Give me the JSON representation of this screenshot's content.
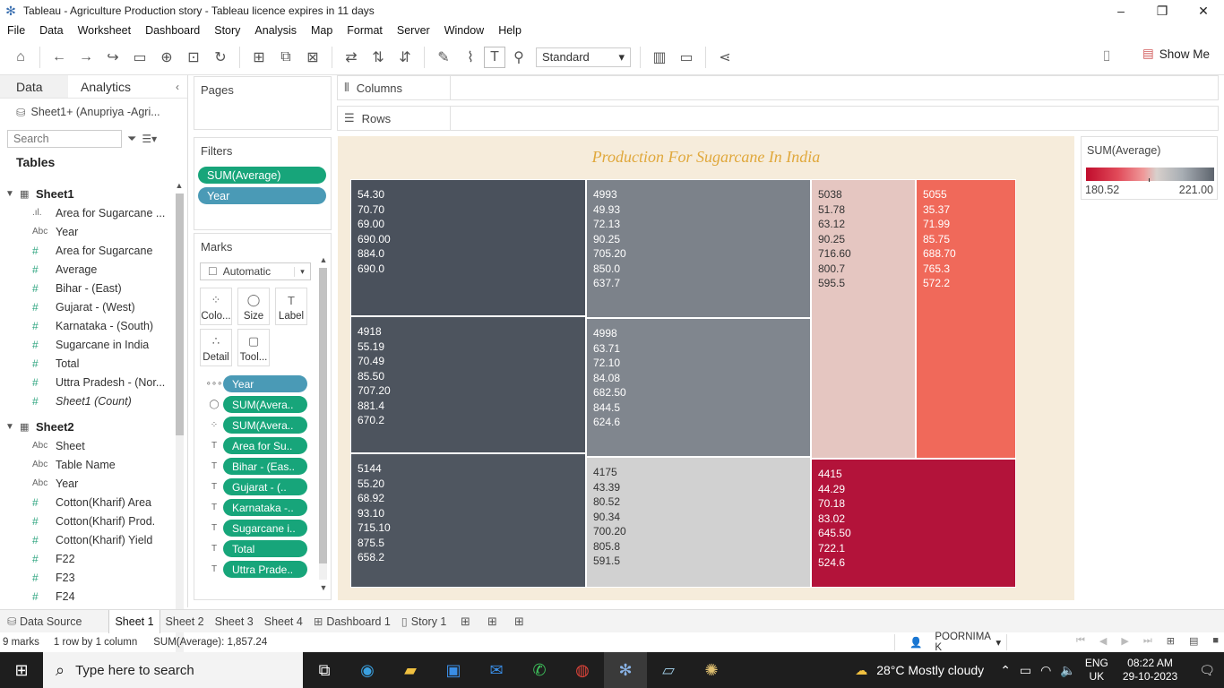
{
  "window": {
    "title": "Tableau - Agriculture Production story - Tableau licence expires in 11 days",
    "minimize": "–",
    "maximize": "❐",
    "close": "✕"
  },
  "menu": [
    "File",
    "Data",
    "Worksheet",
    "Dashboard",
    "Story",
    "Analysis",
    "Map",
    "Format",
    "Server",
    "Window",
    "Help"
  ],
  "toolbar": {
    "fit_value": "Standard",
    "show_me_label": "Show Me"
  },
  "data_pane": {
    "tab_data": "Data",
    "tab_analytics": "Analytics",
    "collapse": "‹",
    "datasource": "Sheet1+ (Anupriya -Agri...",
    "search_placeholder": "Search",
    "tables_title": "Tables",
    "sheet1": {
      "name": "Sheet1",
      "fields": [
        {
          "type": ".ıl.",
          "name": "Area for Sugarcane ...",
          "measure": false,
          "italic": false
        },
        {
          "type": "Abc",
          "name": "Year",
          "measure": false,
          "italic": false
        },
        {
          "type": "#",
          "name": "Area for Sugarcane",
          "measure": true,
          "italic": false
        },
        {
          "type": "#",
          "name": "Average",
          "measure": true,
          "italic": false
        },
        {
          "type": "#",
          "name": "Bihar - (East)",
          "measure": true,
          "italic": false
        },
        {
          "type": "#",
          "name": "Gujarat - (West)",
          "measure": true,
          "italic": false
        },
        {
          "type": "#",
          "name": "Karnataka - (South)",
          "measure": true,
          "italic": false
        },
        {
          "type": "#",
          "name": "Sugarcane in India",
          "measure": true,
          "italic": false
        },
        {
          "type": "#",
          "name": "Total",
          "measure": true,
          "italic": false
        },
        {
          "type": "#",
          "name": "Uttra Pradesh - (Nor...",
          "measure": true,
          "italic": false
        },
        {
          "type": "#",
          "name": "Sheet1 (Count)",
          "measure": true,
          "italic": true
        }
      ]
    },
    "sheet2": {
      "name": "Sheet2",
      "fields": [
        {
          "type": "Abc",
          "name": "Sheet",
          "measure": false,
          "italic": false
        },
        {
          "type": "Abc",
          "name": "Table Name",
          "measure": false,
          "italic": false
        },
        {
          "type": "Abc",
          "name": "Year",
          "measure": false,
          "italic": false
        },
        {
          "type": "#",
          "name": "Cotton(Kharif) Area",
          "measure": true,
          "italic": false
        },
        {
          "type": "#",
          "name": "Cotton(Kharif) Prod.",
          "measure": true,
          "italic": false
        },
        {
          "type": "#",
          "name": "Cotton(Kharif) Yield",
          "measure": true,
          "italic": false
        },
        {
          "type": "#",
          "name": "F22",
          "measure": true,
          "italic": false
        },
        {
          "type": "#",
          "name": "F23",
          "measure": true,
          "italic": false
        },
        {
          "type": "#",
          "name": "F24",
          "measure": true,
          "italic": false
        }
      ]
    }
  },
  "pages": {
    "title": "Pages"
  },
  "filters": {
    "title": "Filters",
    "pills": [
      {
        "label": "SUM(Average)",
        "color": "green"
      },
      {
        "label": "Year",
        "color": "blue"
      }
    ]
  },
  "marks": {
    "title": "Marks",
    "type": "Automatic",
    "buttons": [
      {
        "label": "Colo...",
        "icon": "color-icon",
        "glyph": "⁘"
      },
      {
        "label": "Size",
        "icon": "size-icon",
        "glyph": "◯"
      },
      {
        "label": "Label",
        "icon": "label-icon",
        "glyph": "T"
      },
      {
        "label": "Detail",
        "icon": "detail-icon",
        "glyph": "∴"
      },
      {
        "label": "Tool...",
        "icon": "tooltip-icon",
        "glyph": "▢"
      }
    ],
    "fields": [
      {
        "icon": "detail-icon",
        "glyph": "∘∘∘",
        "label": "Year",
        "color": "blue"
      },
      {
        "icon": "size-icon",
        "glyph": "◯",
        "label": "SUM(Avera..",
        "color": "green"
      },
      {
        "icon": "color-icon",
        "glyph": "⁘",
        "label": "SUM(Avera..",
        "color": "green"
      },
      {
        "icon": "label-icon",
        "glyph": "T",
        "label": "Area for Su..",
        "color": "green"
      },
      {
        "icon": "label-icon",
        "glyph": "T",
        "label": "Bihar - (Eas..",
        "color": "green"
      },
      {
        "icon": "label-icon",
        "glyph": "T",
        "label": "Gujarat - (..",
        "color": "green"
      },
      {
        "icon": "label-icon",
        "glyph": "T",
        "label": "Karnataka -..",
        "color": "green"
      },
      {
        "icon": "label-icon",
        "glyph": "T",
        "label": "Sugarcane i..",
        "color": "green"
      },
      {
        "icon": "label-icon",
        "glyph": "T",
        "label": "Total",
        "color": "green"
      },
      {
        "icon": "label-icon",
        "glyph": "T",
        "label": "Uttra Prade..",
        "color": "green"
      }
    ]
  },
  "shelves": {
    "columns": "Columns",
    "rows": "Rows"
  },
  "viz": {
    "title": "Production For Sugarcane In India",
    "background": "#f6ecdb",
    "title_color": "#e0a83c"
  },
  "chart_data": {
    "type": "treemap",
    "title": "Production For Sugarcane In India",
    "cells": [
      {
        "values": [
          "54.30",
          "70.70",
          "69.00",
          "690.00",
          "884.0",
          "690.0"
        ],
        "color": "#4a515c",
        "text": "light"
      },
      {
        "values": [
          "4918",
          "55.19",
          "70.49",
          "85.50",
          "707.20",
          "881.4",
          "670.2"
        ],
        "color": "#4d545e",
        "text": "light"
      },
      {
        "values": [
          "5144",
          "55.20",
          "68.92",
          "93.10",
          "715.10",
          "875.5",
          "658.2"
        ],
        "color": "#4f5660",
        "text": "light"
      },
      {
        "values": [
          "4993",
          "49.93",
          "72.13",
          "90.25",
          "705.20",
          "850.0",
          "637.7"
        ],
        "color": "#7c828a",
        "text": "light"
      },
      {
        "values": [
          "4998",
          "63.71",
          "72.10",
          "84.08",
          "682.50",
          "844.5",
          "624.6"
        ],
        "color": "#80868e",
        "text": "light"
      },
      {
        "values": [
          "4175",
          "43.39",
          "80.52",
          "90.34",
          "700.20",
          "805.8",
          "591.5"
        ],
        "color": "#d1d1d1",
        "text": "dark"
      },
      {
        "values": [
          "5038",
          "51.78",
          "63.12",
          "90.25",
          "716.60",
          "800.7",
          "595.5"
        ],
        "color": "#e5c6c1",
        "text": "dark"
      },
      {
        "values": [
          "5055",
          "35.37",
          "71.99",
          "85.75",
          "688.70",
          "765.3",
          "572.2"
        ],
        "color": "#f0695a",
        "text": "light"
      },
      {
        "values": [
          "4415",
          "44.29",
          "70.18",
          "83.02",
          "645.50",
          "722.1",
          "524.6"
        ],
        "color": "#b3133a",
        "text": "light"
      }
    ],
    "legend": {
      "title": "SUM(Average)",
      "min": "180.52",
      "max": "221.00"
    }
  },
  "tabs": {
    "data_source": "Data Source",
    "sheets": [
      {
        "label": "Sheet 1",
        "active": true,
        "icon": ""
      },
      {
        "label": "Sheet 2",
        "active": false,
        "icon": ""
      },
      {
        "label": "Sheet 3",
        "active": false,
        "icon": ""
      },
      {
        "label": "Sheet 4",
        "active": false,
        "icon": ""
      },
      {
        "label": "Dashboard 1",
        "active": false,
        "icon": "⊞"
      },
      {
        "label": "Story 1",
        "active": false,
        "icon": "▯"
      }
    ]
  },
  "status": {
    "marks": "9 marks",
    "rows": "1 row  by  1 column",
    "sum": "SUM(Average): 1,857.24",
    "user": "POORNIMA K"
  },
  "taskbar": {
    "search_placeholder": "Type here to search",
    "weather": "28°C  Mostly cloudy",
    "lang1": "ENG",
    "lang2": "UK",
    "time": "08:22 AM",
    "date": "29-10-2023",
    "notif": "1"
  }
}
